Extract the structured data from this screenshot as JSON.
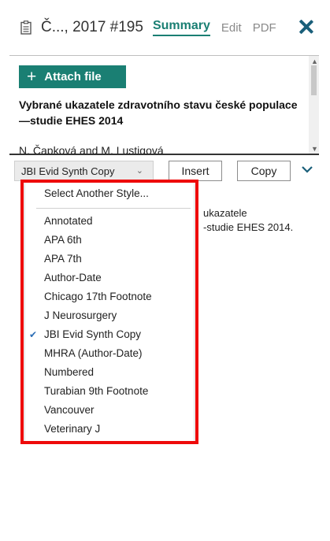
{
  "header": {
    "reference_title": "Č..., 2017 #195",
    "tabs": [
      {
        "label": "Summary",
        "active": true
      },
      {
        "label": "Edit",
        "active": false
      },
      {
        "label": "PDF",
        "active": false
      }
    ],
    "close_icon": "close-icon",
    "doc_icon": "document-icon"
  },
  "summary": {
    "attach_button": "Attach file",
    "article_title": "Vybrané ukazatele zdravotního stavu české populace—studie EHES 2014",
    "authors": "N. Čapková and M. Lustigová"
  },
  "toolbar": {
    "selected_style": "JBI Evid Synth Copy",
    "insert_label": "Insert",
    "copy_label": "Copy"
  },
  "citation": {
    "line1": "ukazatele",
    "line2": "-studie EHES 2014."
  },
  "style_dropdown": {
    "header": "Select Another Style...",
    "items": [
      {
        "label": "Annotated",
        "checked": false
      },
      {
        "label": "APA 6th",
        "checked": false
      },
      {
        "label": "APA 7th",
        "checked": false
      },
      {
        "label": "Author-Date",
        "checked": false
      },
      {
        "label": "Chicago 17th Footnote",
        "checked": false
      },
      {
        "label": "J Neurosurgery",
        "checked": false
      },
      {
        "label": "JBI Evid Synth Copy",
        "checked": true
      },
      {
        "label": "MHRA (Author-Date)",
        "checked": false
      },
      {
        "label": "Numbered",
        "checked": false
      },
      {
        "label": "Turabian 9th Footnote",
        "checked": false
      },
      {
        "label": "Vancouver",
        "checked": false
      },
      {
        "label": "Veterinary J",
        "checked": false
      }
    ]
  },
  "colors": {
    "accent": "#1a7f73",
    "highlight": "#ee0a0a",
    "check": "#2a6db5"
  }
}
